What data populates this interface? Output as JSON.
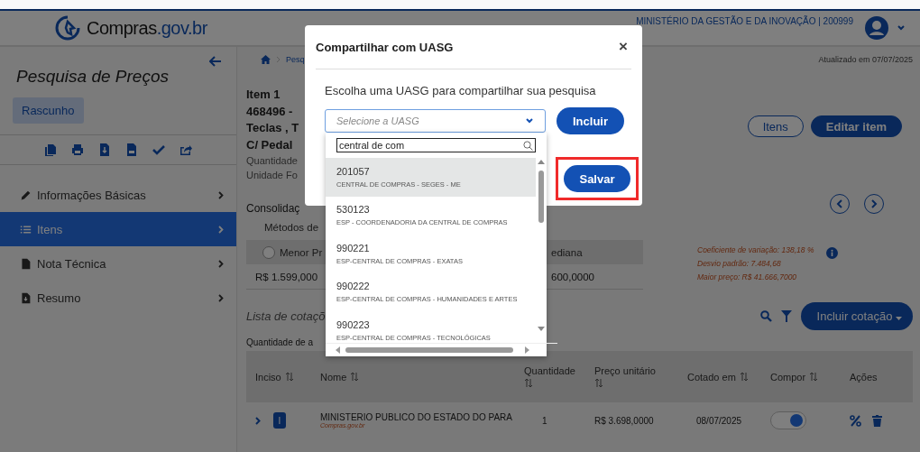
{
  "header": {
    "logo_name": "Compras",
    "logo_domain": ".gov.br",
    "organization": "MINISTÉRIO DA GESTÃO E DA INOVAÇÃO | 200999"
  },
  "sidebar": {
    "title": "Pesquisa de Preços",
    "status": "Rascunho",
    "items": [
      {
        "label": "Informações Básicas",
        "kind": "pencil",
        "selected": false
      },
      {
        "label": "Itens",
        "kind": "list",
        "selected": true
      },
      {
        "label": "Nota Técnica",
        "kind": "file",
        "selected": false
      },
      {
        "label": "Resumo",
        "kind": "download",
        "selected": false
      }
    ]
  },
  "breadcrumb": "Pesq",
  "updated": "Atualizado em 07/07/2025",
  "item": {
    "lines": [
      "Item 1",
      "468496 -",
      "Teclas , T",
      "C/ Pedal"
    ],
    "details": [
      "Quantidade",
      "Unidade Fo"
    ]
  },
  "item_buttons": [
    {
      "label": "Itens",
      "kind": "outline"
    },
    {
      "label": "Editar item",
      "kind": "filled"
    }
  ],
  "consolidation": {
    "title": "Consolidaç",
    "methods_label": "Métodos de",
    "methods": [
      {
        "label": "Menor Pr",
        "value": "R$ 1.599,000",
        "selected": false
      },
      {
        "label": "ediana",
        "value": "600,0000"
      }
    ],
    "stats": [
      "Coeficiente de variação: 138,18 %",
      "Desvio padrão: 7.484,68",
      "Maior preço: R$ 41.666,7000"
    ]
  },
  "list": {
    "title": "Lista de cotaçõ",
    "add_button": "Incluir cotação",
    "samples": "Quantidade de a",
    "columns": [
      {
        "label": "Inciso",
        "sortable": true
      },
      {
        "label": "Nome",
        "sortable": true
      },
      {
        "label": "Quantidade",
        "sortable": true
      },
      {
        "label": "Preço unitário",
        "sortable": true
      },
      {
        "label": "Cotado em",
        "sortable": true
      },
      {
        "label": "Compor",
        "sortable": true
      },
      {
        "label": "Ações",
        "sortable": false
      }
    ],
    "rows": [
      {
        "inciso": "I",
        "name": "MINISTERIO PUBLICO DO ESTADO DO PARA",
        "source": "Compras.gov.br",
        "quantity": "1",
        "price": "R$ 3.698,0000",
        "date": "08/07/2025",
        "compose": true
      }
    ]
  },
  "modal": {
    "title": "Compartilhar com UASG",
    "close": "×",
    "prompt": "Escolha uma UASG para compartilhar sua pesquisa",
    "select_placeholder": "Selecione a UASG",
    "include_button": "Incluir",
    "search_value": "central de com",
    "options": [
      {
        "code": "201057",
        "name": "CENTRAL DE COMPRAS - SEGES - ME",
        "selected": true
      },
      {
        "code": "530123",
        "name": "ESP - COORDENADORIA DA CENTRAL DE COMPRAS",
        "selected": false
      },
      {
        "code": "990221",
        "name": "ESP-CENTRAL DE COMPRAS - EXATAS",
        "selected": false
      },
      {
        "code": "990222",
        "name": "ESP-CENTRAL DE COMPRAS - HUMANIDADES E ARTES",
        "selected": false
      },
      {
        "code": "990223",
        "name": "ESP-CENTRAL DE COMPRAS - TECNOLÓGICAS",
        "selected": false
      }
    ],
    "save_button": "Salvar",
    "save_highlighted": true
  }
}
